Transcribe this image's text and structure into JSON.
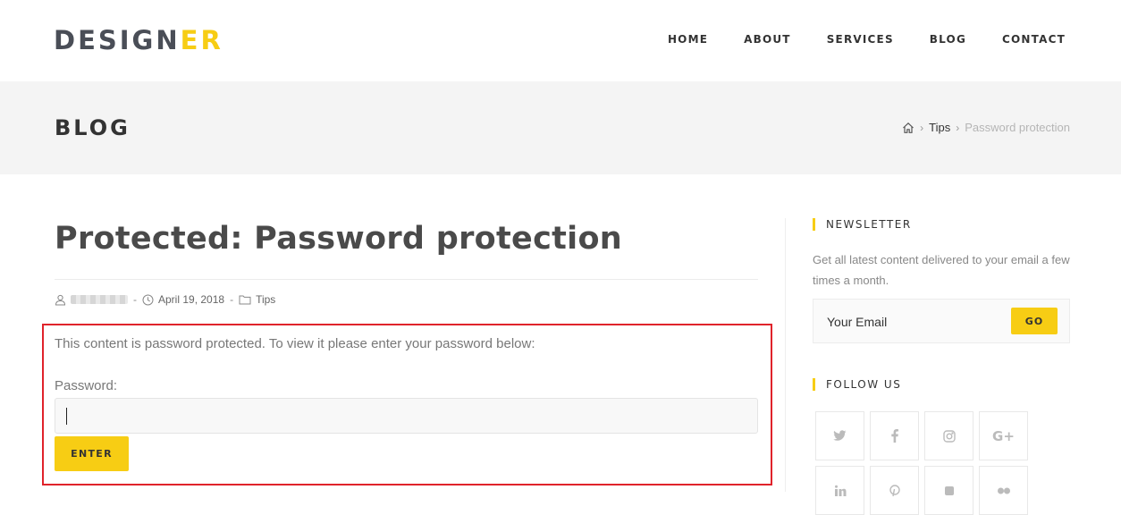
{
  "header": {
    "logo_main": "DESIGN",
    "logo_accent": "ER",
    "nav": [
      "HOME",
      "ABOUT",
      "SERVICES",
      "BLOG",
      "CONTACT"
    ]
  },
  "titlebar": {
    "title": "BLOG",
    "breadcrumb": {
      "home_icon": "home-icon",
      "items": [
        "Tips",
        "Password protection"
      ]
    }
  },
  "post": {
    "title": "Protected: Password protection",
    "meta": {
      "date": "April 19, 2018",
      "category": "Tips"
    },
    "protected_message": "This content is password protected. To view it please enter your password below:",
    "password_label": "Password:",
    "password_value": "",
    "enter_label": "ENTER"
  },
  "sidebar": {
    "newsletter": {
      "title": "NEWSLETTER",
      "description": "Get all latest content delivered to your email a few times a month.",
      "email_placeholder": "Your Email",
      "go_label": "GO"
    },
    "follow": {
      "title": "FOLLOW US",
      "icons": [
        "twitter-icon",
        "facebook-icon",
        "instagram-icon",
        "google-plus-icon",
        "linkedin-icon",
        "pinterest-icon",
        "dribbble-icon",
        "flickr-icon"
      ],
      "google_plus_text": "G+"
    }
  },
  "colors": {
    "accent": "#f7cd14",
    "highlight_border": "#e0232b",
    "titlebar_bg": "#f4f4f4"
  }
}
